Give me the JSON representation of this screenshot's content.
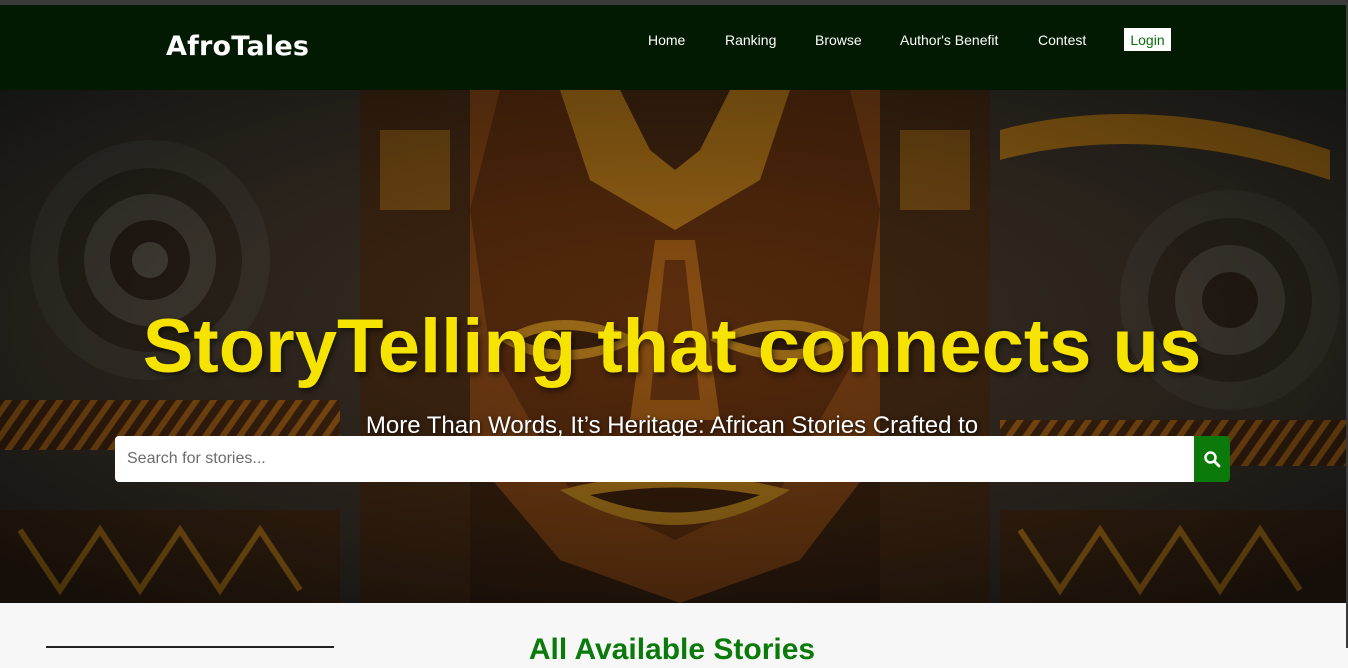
{
  "brand": {
    "logo_text": "AfroTales"
  },
  "nav": {
    "items": [
      {
        "label": "Home"
      },
      {
        "label": "Ranking"
      },
      {
        "label": "Browse"
      },
      {
        "label": "Author's Benefit"
      },
      {
        "label": "Contest"
      }
    ],
    "login_label": "Login"
  },
  "hero": {
    "title": "StoryTelling that connects us",
    "subtitle": "More Than Words, It’s Heritage: African Stories Crafted to Empower and Unite"
  },
  "search": {
    "placeholder": "Search for stories...",
    "value": "",
    "button_icon": "search-icon"
  },
  "stories_section": {
    "title": "All Available Stories"
  },
  "colors": {
    "navbar_bg": "#021a02",
    "hero_title": "#f7e300",
    "accent_green": "#0b7a0b",
    "section_title": "#0a7a0a"
  }
}
